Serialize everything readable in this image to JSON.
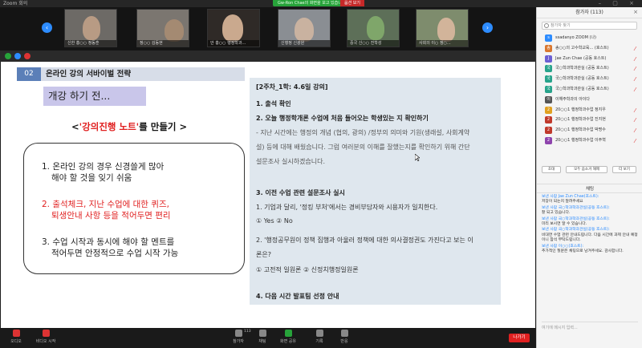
{
  "window": {
    "title": "Zoom 회의"
  },
  "share_banner": {
    "label": "Gw-Ron Chae의 화면을 보고 있습니다",
    "stop_label": "옵션 보기"
  },
  "video": {
    "tiles": [
      {
        "caption": "신한 홍○○ 정동훈",
        "bg": "#6d6a66"
      },
      {
        "caption": "정○○ 김동현",
        "bg": "#7b7670"
      },
      {
        "caption": "안 홍○○ 행정학과...",
        "bg": "#2f2a27"
      },
      {
        "caption": "신행정 신광원",
        "bg": "#8a8e93"
      },
      {
        "caption": "중국 신○○ 진학성",
        "bg": "#5d6f58"
      },
      {
        "caption": "사회의 이○ 정○...",
        "bg": "#7e8c6d"
      }
    ]
  },
  "slide": {
    "section_number": "02",
    "section_title": "온라인 강의 서바이벌 전략",
    "before_label": "개강 하기 전...",
    "note_heading_open": "<",
    "note_heading_red": "'강의진행 노트'",
    "note_heading_rest": "를 만들기 >",
    "tips": [
      {
        "line1": "1. 온라인 강의 경우 신경쓸게 많아",
        "line2": "해야 할 것을 잊기 쉬움",
        "red": false
      },
      {
        "line1": "2. 출석체크, 지난 수업에 대한 퀴즈,",
        "line2": "퇴생안내 사항 등을 적어두면 편리",
        "red": true
      },
      {
        "line1": "3. 수업 시작과 동시에 해야 할 멘트를",
        "line2": "적어두면 안정적으로 수업 시작 가능",
        "red": false
      }
    ],
    "notes": {
      "title": "[2주차_1학: 4.6일 강의]",
      "items": [
        {
          "text": "1. 출석 확인",
          "style": "bold"
        },
        {
          "text": "2. 오늘 행정학개론 수업에 처음 들어오는 학생있는 지 확인하기",
          "style": "bold"
        },
        {
          "text": "- 지난 시간에는 행정의 개념 (협의, 광의) /정부의 의미와 기원(생래설, 사회계약",
          "style": "gray"
        },
        {
          "text": "설) 등에 대해 배웠습니다. 그럼 여러분의 이해를 잘했는지를 확인하기 위해 간단",
          "style": "gray"
        },
        {
          "text": "설문조사 실시하겠습니다.",
          "style": "gray"
        },
        {
          "text": "3. 이전 수업 관련 설문조사 실시",
          "style": "bold"
        },
        {
          "text": "1. 기업과 달리, '정킹 부처'에서는 경비부담자와 시용자가 일치한다.",
          "style": "normal"
        },
        {
          "text": "① Yes ② No",
          "style": "normal"
        },
        {
          "text": "2. '행정공무원이 정책 집행과 아울러 정책에 대한 의사결정권도 가진다고 보는 이",
          "style": "normal"
        },
        {
          "text": "론은?",
          "style": "normal"
        },
        {
          "text": "① 고전적 일원론 ② 신정치행정일원론",
          "style": "normal"
        },
        {
          "text": "4. 다음 시간 발표팀 선정 안내",
          "style": "bold"
        }
      ]
    }
  },
  "controls": {
    "items": [
      {
        "label": "오디오",
        "icon": "mic-icon"
      },
      {
        "label": "비디오 시작",
        "icon": "video-icon"
      },
      {
        "label": "참가자",
        "icon": "participants-icon"
      },
      {
        "label": "채팅",
        "icon": "chat-icon"
      },
      {
        "label": "화면 공유",
        "icon": "share-icon"
      },
      {
        "label": "기록",
        "icon": "record-icon"
      },
      {
        "label": "반응",
        "icon": "reactions-icon"
      }
    ],
    "participant_count": "113",
    "end_label": "나가기"
  },
  "panel": {
    "participants_title": "참가자 (113)",
    "search_placeholder": "참가자 찾기",
    "participants": [
      {
        "name": "ssadanyo ZOOM (나)",
        "color": "#2d8cff",
        "initial": "s"
      },
      {
        "name": "송○○의 고수학교육... (호스트)",
        "color": "#d9772f",
        "initial": "송"
      },
      {
        "name": "Jae Zun Chae (공동 호스트)",
        "color": "#6b5fd3",
        "initial": "J"
      },
      {
        "name": "국○학과학과관실 (공동 호스트)",
        "color": "#27a38b",
        "initial": "국"
      },
      {
        "name": "국○학과학과관실 (공동 호스트)",
        "color": "#27a38b",
        "initial": "국"
      },
      {
        "name": "국○학과학과관실 (공동 호스트)",
        "color": "#27a38b",
        "initial": "국"
      },
      {
        "name": "이해주학과의 아이다",
        "color": "#555555",
        "initial": "이"
      },
      {
        "name": "20○○1 행정학과수업 정지우",
        "color": "#e0a020",
        "initial": "2"
      },
      {
        "name": "20○○1 행정학과수업 진지현",
        "color": "#c0392b",
        "initial": "2"
      },
      {
        "name": "20○○1 행정학과수업 박명수",
        "color": "#c0392b",
        "initial": "2"
      },
      {
        "name": "20○○1 행정학과수업 이주혁",
        "color": "#8e44ad",
        "initial": "2"
      }
    ],
    "buttons": [
      "초대",
      "모두 음소거 해제",
      "더 보기"
    ],
    "chat_title": "채팅",
    "chat": [
      {
        "from": "보낸 사람 Jae Zun Chae(호스트):",
        "text": "저장이 되는지 알려주세요"
      },
      {
        "from": "보낸 사람 국○학과학과관실(공동 호스트):",
        "text": "잘 되고 있습니다."
      },
      {
        "from": "보낸 사람 국○학과학과관실(공동 호스트):",
        "text": "미리 보시면 알 수 있습니다."
      },
      {
        "from": "보낸 사람 국○학과학과관실(공동 호스트):",
        "text": "비대면 수업 관련 안내드립니다. 다음 시간에 과제 안내 예정이니 참석 부탁드립니다."
      },
      {
        "from": "보낸 사람 이○○(호스트):",
        "text": "추가적인 질문은 채팅으로 남겨주세요. 감사합니다."
      }
    ],
    "chat_input_placeholder": "여기에 메시지 입력..."
  }
}
